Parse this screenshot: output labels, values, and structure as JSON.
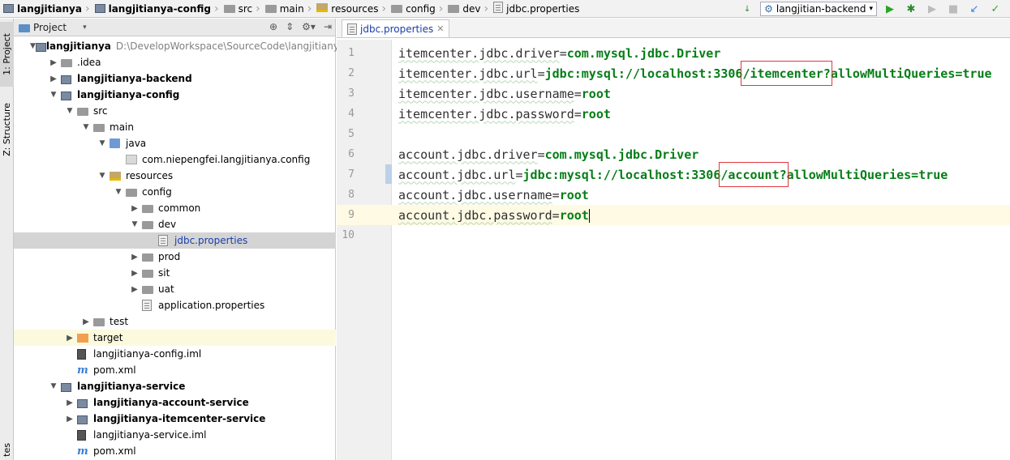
{
  "breadcrumb": [
    {
      "label": "langjitianya",
      "icon": "module-icon",
      "bold": true
    },
    {
      "label": "langjitianya-config",
      "icon": "module-icon",
      "bold": true
    },
    {
      "label": "src",
      "icon": "folder-icon"
    },
    {
      "label": "main",
      "icon": "folder-icon"
    },
    {
      "label": "resources",
      "icon": "resources-folder-icon"
    },
    {
      "label": "config",
      "icon": "folder-icon"
    },
    {
      "label": "dev",
      "icon": "folder-icon"
    },
    {
      "label": "jdbc.properties",
      "icon": "properties-file-icon"
    }
  ],
  "run_config": {
    "label": "langjitian-backend"
  },
  "left_strip": {
    "project_tab": "1: Project",
    "structure_tab": "Z: Structure",
    "bottom_tab": "tes"
  },
  "project_panel": {
    "title": "Project"
  },
  "tree": [
    {
      "label": "langjitianya",
      "path": "D:\\DevelopWorkspace\\SourceCode\\langjitianya",
      "depth": 0,
      "arrow": "down",
      "icon": "module",
      "bold": true
    },
    {
      "label": ".idea",
      "depth": 1,
      "arrow": "right",
      "icon": "folder-dark"
    },
    {
      "label": "langjitianya-backend",
      "depth": 1,
      "arrow": "right",
      "icon": "module",
      "bold": true
    },
    {
      "label": "langjitianya-config",
      "depth": 1,
      "arrow": "down",
      "icon": "module",
      "bold": true
    },
    {
      "label": "src",
      "depth": 2,
      "arrow": "down",
      "icon": "folder-dark"
    },
    {
      "label": "main",
      "depth": 3,
      "arrow": "down",
      "icon": "folder-dark"
    },
    {
      "label": "java",
      "depth": 4,
      "arrow": "down",
      "icon": "java"
    },
    {
      "label": "com.niepengfei.langjitianya.config",
      "depth": 5,
      "arrow": "none",
      "icon": "package"
    },
    {
      "label": "resources",
      "depth": 4,
      "arrow": "down",
      "icon": "resources"
    },
    {
      "label": "config",
      "depth": 5,
      "arrow": "down",
      "icon": "folder-dark"
    },
    {
      "label": "common",
      "depth": 6,
      "arrow": "right",
      "icon": "folder-dark"
    },
    {
      "label": "dev",
      "depth": 6,
      "arrow": "down",
      "icon": "folder-dark"
    },
    {
      "label": "jdbc.properties",
      "depth": 7,
      "arrow": "none",
      "icon": "properties",
      "selected": true,
      "blue": true
    },
    {
      "label": "prod",
      "depth": 6,
      "arrow": "right",
      "icon": "folder-dark"
    },
    {
      "label": "sit",
      "depth": 6,
      "arrow": "right",
      "icon": "folder-dark"
    },
    {
      "label": "uat",
      "depth": 6,
      "arrow": "right",
      "icon": "folder-dark"
    },
    {
      "label": "application.properties",
      "depth": 6,
      "arrow": "none",
      "icon": "properties"
    },
    {
      "label": "test",
      "depth": 3,
      "arrow": "right",
      "icon": "folder-dark"
    },
    {
      "label": "target",
      "depth": 2,
      "arrow": "right",
      "icon": "target",
      "highlight": true
    },
    {
      "label": "langjitianya-config.iml",
      "depth": 2,
      "arrow": "none",
      "icon": "iml"
    },
    {
      "label": "pom.xml",
      "depth": 2,
      "arrow": "none",
      "icon": "maven"
    },
    {
      "label": "langjitianya-service",
      "depth": 1,
      "arrow": "down",
      "icon": "module",
      "bold": true
    },
    {
      "label": "langjitianya-account-service",
      "depth": 2,
      "arrow": "right",
      "icon": "module",
      "bold": true
    },
    {
      "label": "langjitianya-itemcenter-service",
      "depth": 2,
      "arrow": "right",
      "icon": "module",
      "bold": true
    },
    {
      "label": "langjitianya-service.iml",
      "depth": 2,
      "arrow": "none",
      "icon": "iml"
    },
    {
      "label": "pom.xml",
      "depth": 2,
      "arrow": "none",
      "icon": "maven"
    }
  ],
  "editor": {
    "tab_label": "jdbc.properties",
    "lines": [
      {
        "num": "1",
        "key": "itemcenter.jdbc.driver",
        "value": "com.mysql.jdbc.Driver"
      },
      {
        "num": "2",
        "key": "itemcenter.jdbc.url",
        "value": "jdbc:mysql://localhost:3306/itemcenter?allowMultiQueries=true",
        "boxed": "/itemcenter?"
      },
      {
        "num": "3",
        "key": "itemcenter.jdbc.username",
        "value": "root"
      },
      {
        "num": "4",
        "key": "itemcenter.jdbc.password",
        "value": "root"
      },
      {
        "num": "5",
        "key": "",
        "value": ""
      },
      {
        "num": "6",
        "key": "account.jdbc.driver",
        "value": "com.mysql.jdbc.Driver"
      },
      {
        "num": "7",
        "key": "account.jdbc.url",
        "value": "jdbc:mysql://localhost:3306/account?allowMultiQueries=true",
        "boxed": "/account?",
        "modified": true
      },
      {
        "num": "8",
        "key": "account.jdbc.username",
        "value": "root"
      },
      {
        "num": "9",
        "key": "account.jdbc.password",
        "value": "root",
        "current": true
      },
      {
        "num": "10",
        "key": "",
        "value": ""
      }
    ]
  }
}
